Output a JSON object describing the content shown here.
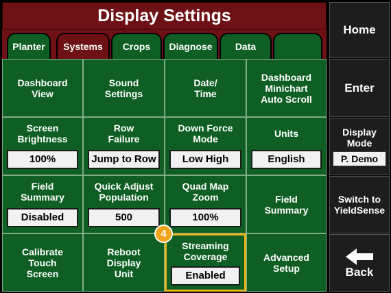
{
  "title": "Display Settings",
  "tabs": [
    {
      "label": "Planter"
    },
    {
      "label": "Systems"
    },
    {
      "label": "Crops"
    },
    {
      "label": "Diagnose"
    },
    {
      "label": "Data"
    },
    {
      "label": ""
    }
  ],
  "active_tab": "Systems",
  "grid": {
    "r1": [
      {
        "label": "Dashboard\nView"
      },
      {
        "label": "Sound\nSettings"
      },
      {
        "label": "Date/\nTime"
      },
      {
        "label": "Dashboard\nMinichart\nAuto Scroll"
      }
    ],
    "r2": [
      {
        "label": "Screen\nBrightness",
        "value": "100%"
      },
      {
        "label": "Row\nFailure",
        "value": "Jump to Row"
      },
      {
        "label": "Down Force\nMode",
        "value": "Low High"
      },
      {
        "label": "Units",
        "value": "English"
      }
    ],
    "r3": [
      {
        "label": "Field\nSummary",
        "value": "Disabled"
      },
      {
        "label": "Quick Adjust\nPopulation",
        "value": "500"
      },
      {
        "label": "Quad Map\nZoom",
        "value": "100%"
      },
      {
        "label": "Field\nSummary"
      }
    ],
    "r4": [
      {
        "label": "Calibrate\nTouch\nScreen"
      },
      {
        "label": "Reboot\nDisplay\nUnit"
      },
      {
        "label": "Streaming\nCoverage",
        "value": "Enabled"
      },
      {
        "label": "Advanced\nSetup"
      }
    ]
  },
  "callout_badge": "4",
  "highlight_color": "#e9b21a",
  "sidebar": {
    "home": "Home",
    "enter": "Enter",
    "display_mode": {
      "label": "Display\nMode",
      "value": "P. Demo"
    },
    "switch": "Switch to\nYieldSense",
    "back": {
      "icon": "arrow-left-icon",
      "label": "Back"
    }
  },
  "colors": {
    "title_bar": "#6e1116",
    "cell_green": "#0f5f25",
    "sidebar": "#1d1d1d"
  }
}
